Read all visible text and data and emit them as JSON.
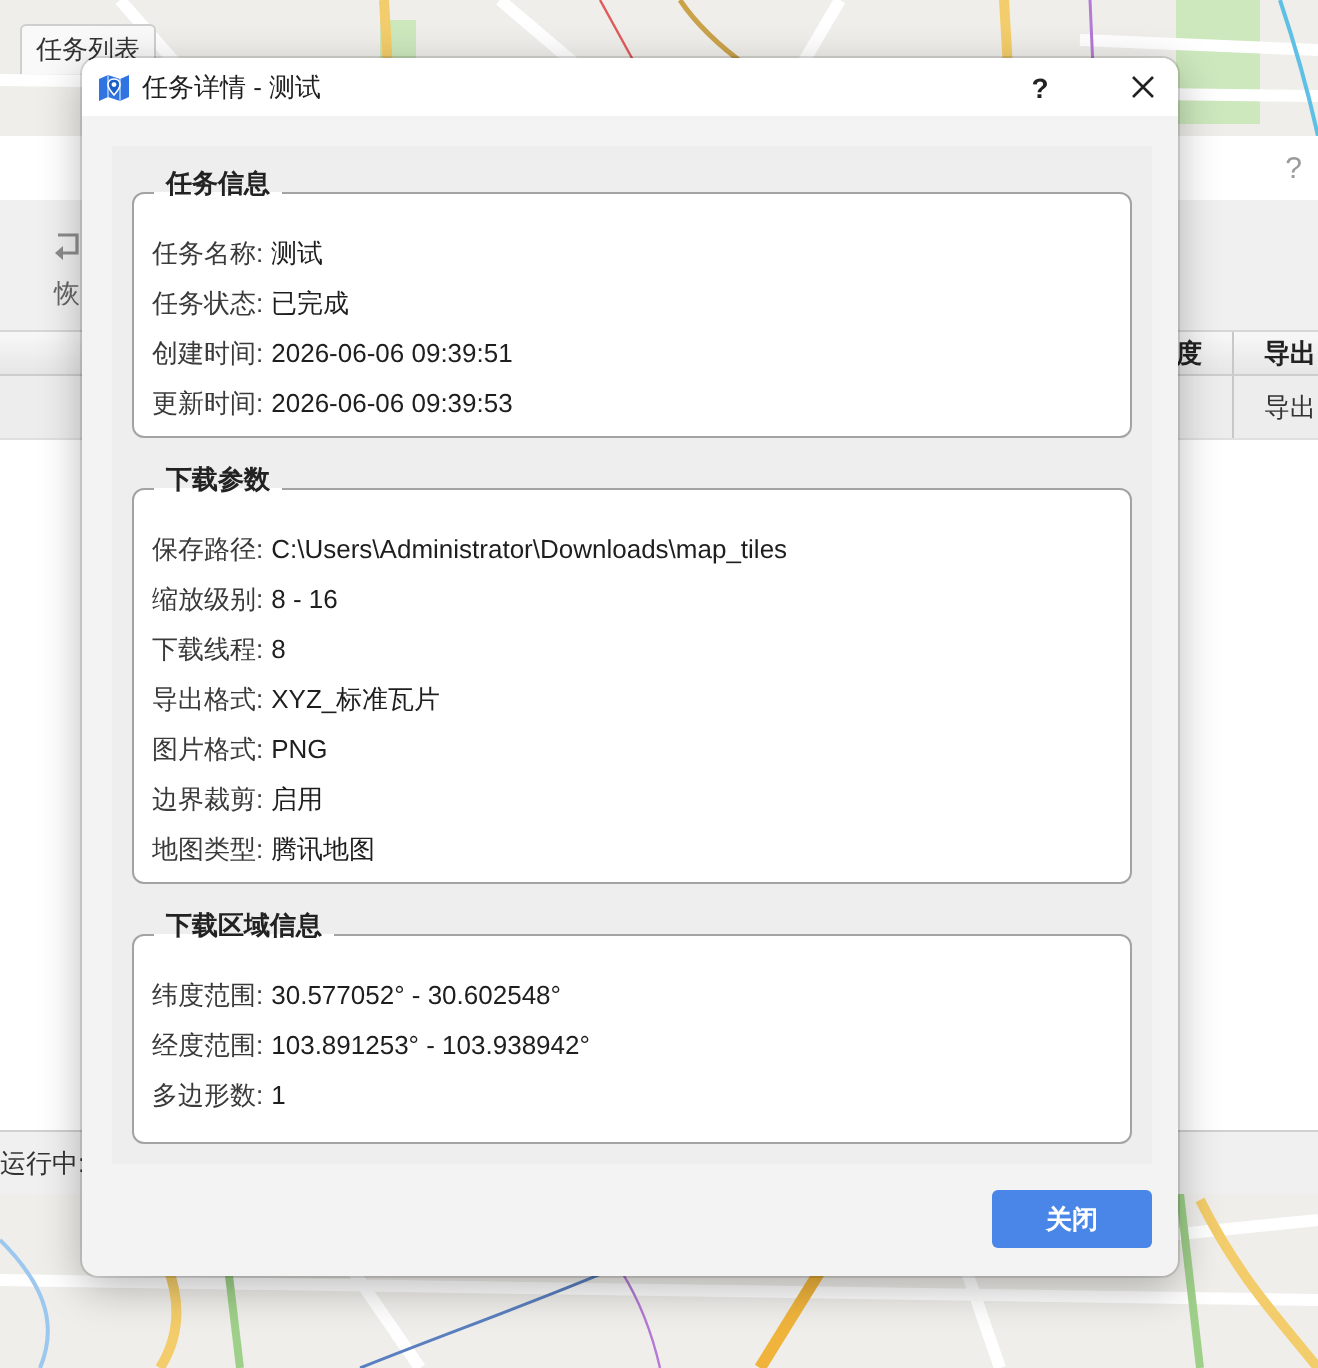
{
  "map_app": {
    "tab": {
      "label": "任务列表"
    }
  },
  "task_list_window": {
    "help_button": "?",
    "toolbar": [
      {
        "label": "恢"
      }
    ],
    "table": {
      "columns": [
        "度",
        "导出"
      ],
      "rows": [
        [
          null,
          "导出"
        ]
      ]
    },
    "status_bar": "运行中:"
  },
  "dialog": {
    "title": "任务详情 - 测试",
    "help_button": "?",
    "groups": [
      {
        "title": "任务信息",
        "rows": [
          {
            "label": "任务名称:",
            "value": "测试"
          },
          {
            "label": "任务状态:",
            "value": "已完成"
          },
          {
            "label": "创建时间:",
            "value": "2026-06-06 09:39:51"
          },
          {
            "label": "更新时间:",
            "value": "2026-06-06 09:39:53"
          }
        ]
      },
      {
        "title": "下载参数",
        "rows": [
          {
            "label": "保存路径:",
            "value": "C:\\Users\\Administrator\\Downloads\\map_tiles"
          },
          {
            "label": "缩放级别:",
            "value": "8 - 16"
          },
          {
            "label": "下载线程:",
            "value": "8"
          },
          {
            "label": "导出格式:",
            "value": "XYZ_标准瓦片"
          },
          {
            "label": "图片格式:",
            "value": "PNG"
          },
          {
            "label": "边界裁剪:",
            "value": "启用"
          },
          {
            "label": "地图类型:",
            "value": "腾讯地图"
          }
        ]
      },
      {
        "title": "下载区域信息",
        "rows": [
          {
            "label": "纬度范围:",
            "value": "30.577052° - 30.602548°"
          },
          {
            "label": "经度范围:",
            "value": "103.891253° - 103.938942°"
          },
          {
            "label": "多边形数:",
            "value": "1"
          }
        ]
      }
    ],
    "buttons": [
      {
        "label": "关闭"
      }
    ]
  }
}
